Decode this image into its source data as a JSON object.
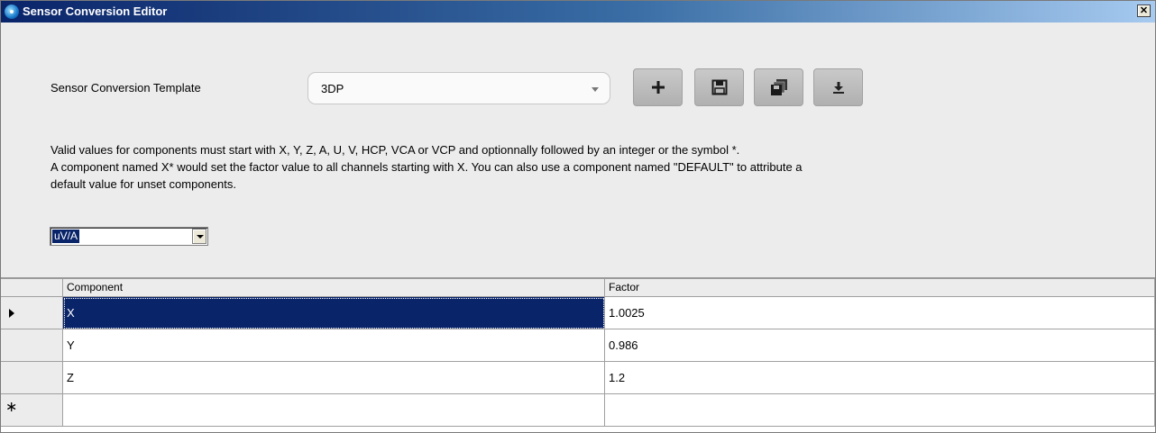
{
  "window": {
    "title": "Sensor Conversion Editor",
    "close_label": "✕"
  },
  "template": {
    "label": "Sensor Conversion Template",
    "selected": "3DP"
  },
  "toolbar": {
    "add_label": "+"
  },
  "description": {
    "line1": "Valid values for components must start with X, Y, Z, A, U, V, HCP, VCA or VCP and optionnally followed by an integer or the symbol *.",
    "line2": "A component named X* would set the factor value to all channels starting with X. You can also use a component named \"DEFAULT\" to attribute a",
    "line3": "default value for unset components."
  },
  "unit": {
    "selected": "uV/A"
  },
  "table": {
    "headers": {
      "component": "Component",
      "factor": "Factor"
    },
    "rows": [
      {
        "component": "X",
        "factor": "1.0025"
      },
      {
        "component": "Y",
        "factor": "0.986"
      },
      {
        "component": "Z",
        "factor": "1.2"
      }
    ],
    "new_row_marker": "∗"
  }
}
